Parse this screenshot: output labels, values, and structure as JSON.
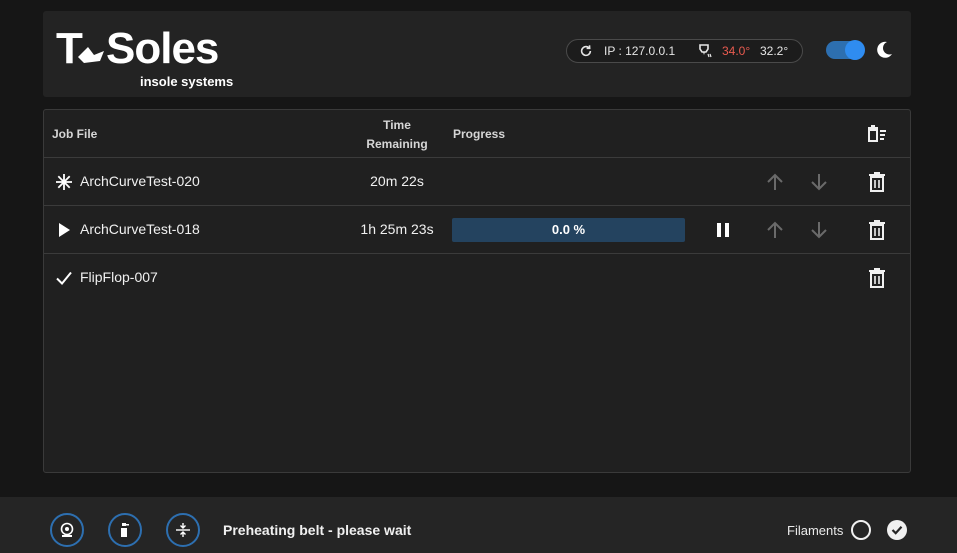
{
  "header": {
    "logo_text": "T Soles",
    "logo_subtitle": "insole systems",
    "ip_label": "IP : 127.0.0.1",
    "nozzle_temp": "34.0°",
    "bed_temp": "32.2°",
    "dark_mode": true
  },
  "table": {
    "col_job_file": "Job File",
    "col_time_line1": "Time",
    "col_time_line2": "Remaining",
    "col_progress": "Progress",
    "rows": [
      {
        "status": "queued",
        "status_icon": "asterisk-icon",
        "name": "ArchCurveTest-020",
        "time": "20m 22s"
      },
      {
        "status": "printing",
        "status_icon": "play-icon",
        "name": "ArchCurveTest-018",
        "time": "1h 25m 23s",
        "progress": 0.0,
        "progress_label": "0.0 %"
      },
      {
        "status": "done",
        "status_icon": "check-icon",
        "name": "FlipFlop-007",
        "time": ""
      }
    ]
  },
  "footer": {
    "message": "Preheating belt - please wait",
    "filaments_label": "Filaments",
    "buttons": [
      "camera-icon",
      "spray-icon",
      "compress-icon"
    ]
  },
  "colors": {
    "accent": "#2f8cf0",
    "hot_temp": "#e85a4f",
    "progress_bg": "#24435f"
  }
}
